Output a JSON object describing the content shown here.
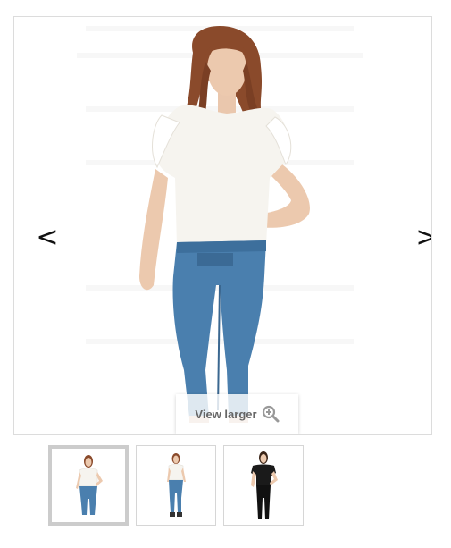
{
  "gallery": {
    "prev_arrow": "<",
    "next_arrow": ">",
    "view_larger_label": "View larger",
    "thumbnails": [
      {
        "name": "thumb-white-top-jeans-front",
        "selected": true
      },
      {
        "name": "thumb-white-top-jeans-full",
        "selected": false
      },
      {
        "name": "thumb-black-top-black-pants",
        "selected": false
      }
    ]
  },
  "colors": {
    "frame_border": "#dcdcdc",
    "selected_thumb_border": "#cccccc",
    "denim": "#4a7fae",
    "top_white": "#f6f4ef",
    "hair": "#8a4a2b",
    "skin": "#eac7ad"
  }
}
